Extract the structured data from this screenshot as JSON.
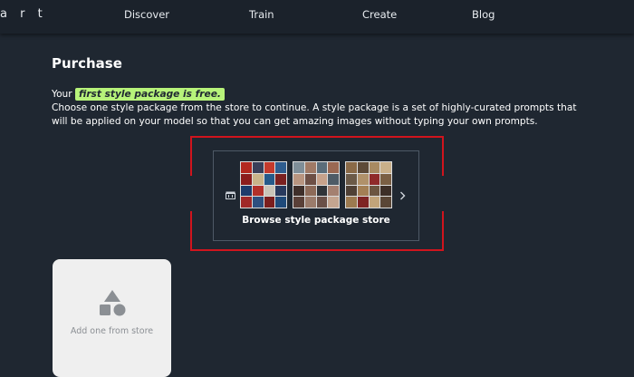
{
  "nav": {
    "brand": "a r t",
    "links": [
      "Discover",
      "Train",
      "Create",
      "Blog"
    ]
  },
  "page": {
    "title": "Purchase",
    "intro_prefix": "Your ",
    "intro_highlight": "first style package is free.",
    "intro_body": "Choose one style package from the store to continue. A style package is a set of highly-curated prompts that will be applied on your model so that you can get amazing images without typing your own prompts."
  },
  "store_card": {
    "label": "Browse style package store",
    "icon": "store-icon",
    "chevron": "chevron-right-icon"
  },
  "add_card": {
    "label": "Add one from store",
    "icon": "shapes-icon"
  },
  "colors": {
    "background": "#1f2731",
    "highlight": "#b7f37a",
    "focus_outline": "#d0141d",
    "add_card_bg": "#efefef"
  }
}
